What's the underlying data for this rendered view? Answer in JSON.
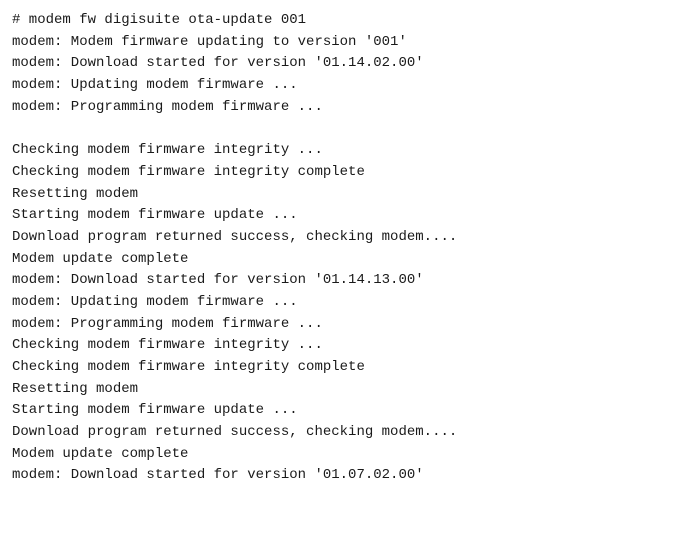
{
  "terminal": {
    "lines": [
      "# modem fw digisuite ota-update 001",
      "modem: Modem firmware updating to version '001'",
      "modem: Download started for version '01.14.02.00'",
      "modem: Updating modem firmware ...",
      "modem: Programming modem firmware ...",
      "",
      "Checking modem firmware integrity ...",
      "Checking modem firmware integrity complete",
      "Resetting modem",
      "Starting modem firmware update ...",
      "Download program returned success, checking modem....",
      "Modem update complete",
      "modem: Download started for version '01.14.13.00'",
      "modem: Updating modem firmware ...",
      "modem: Programming modem firmware ...",
      "Checking modem firmware integrity ...",
      "Checking modem firmware integrity complete",
      "Resetting modem",
      "Starting modem firmware update ...",
      "Download program returned success, checking modem....",
      "Modem update complete",
      "modem: Download started for version '01.07.02.00'"
    ]
  }
}
